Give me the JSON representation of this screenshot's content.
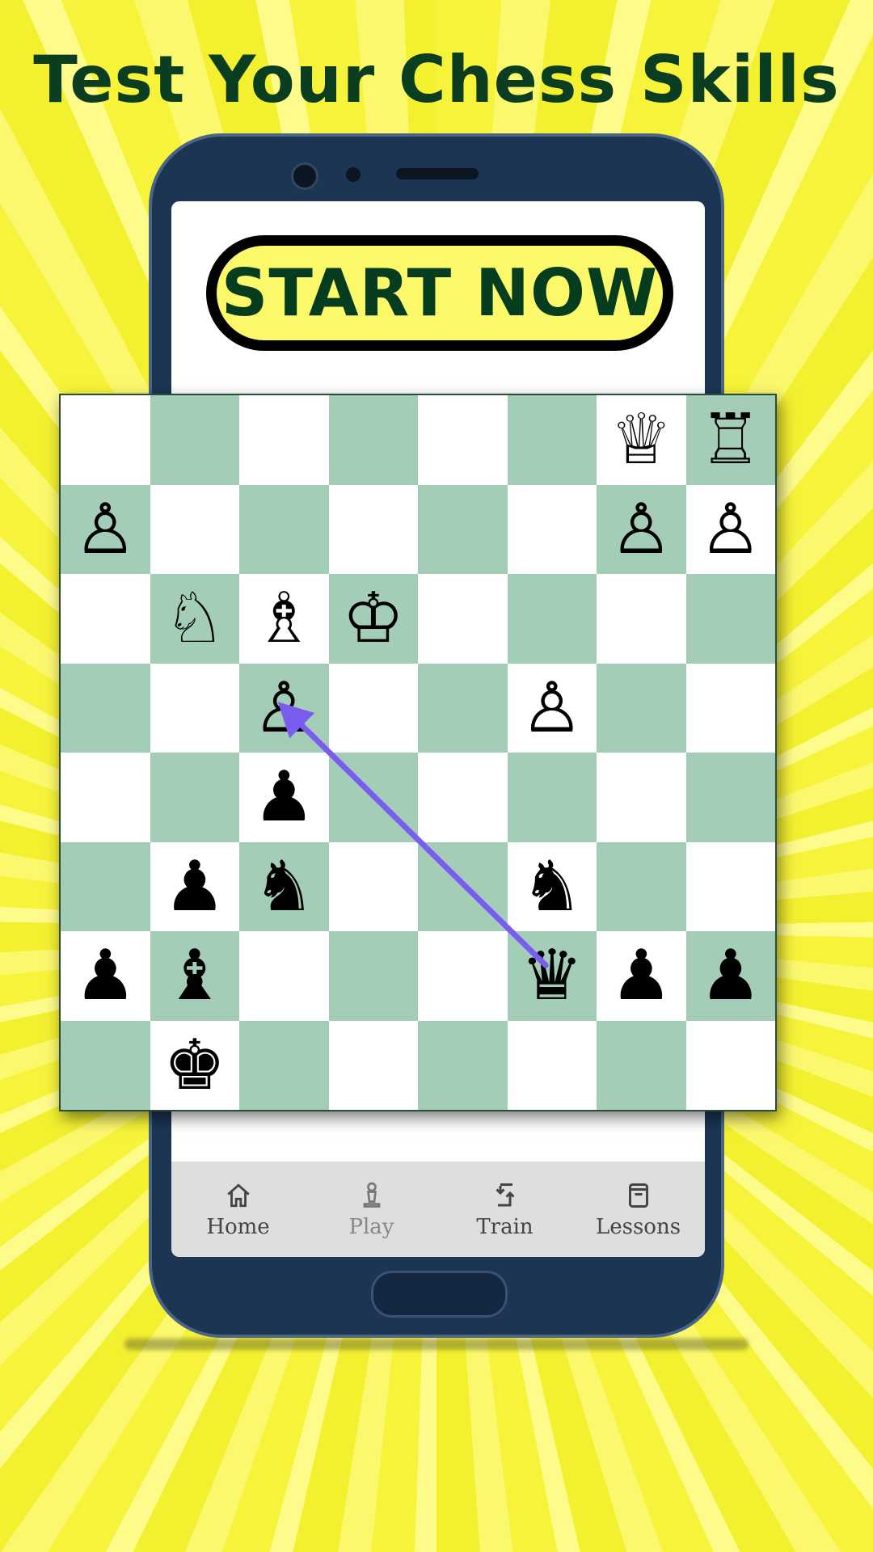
{
  "title": "Test Your Chess Skills",
  "start_button": "START NOW",
  "nav": [
    {
      "label": "Home",
      "icon": "home-icon"
    },
    {
      "label": "Play",
      "icon": "pawn-icon"
    },
    {
      "label": "Train",
      "icon": "swap-icon"
    },
    {
      "label": "Lessons",
      "icon": "book-icon"
    }
  ],
  "colors": {
    "title": "#0b3d20",
    "light_square": "#ffffff",
    "dark_square": "#a4cdb8",
    "arrow": "#7a5cf0",
    "button_fill": "#fbf86a"
  },
  "board": {
    "rows": [
      [
        "",
        "",
        "",
        "",
        "",
        "",
        "white-queen",
        "white-rook"
      ],
      [
        "white-pawn",
        "",
        "",
        "",
        "",
        "",
        "white-pawn",
        "white-pawn"
      ],
      [
        "",
        "white-knight",
        "white-bishop",
        "white-king",
        "",
        "",
        "",
        ""
      ],
      [
        "",
        "",
        "white-pawn",
        "",
        "",
        "white-pawn",
        "",
        ""
      ],
      [
        "",
        "",
        "black-pawn",
        "",
        "",
        "",
        "",
        ""
      ],
      [
        "",
        "black-pawn",
        "black-knight",
        "",
        "",
        "black-knight",
        "",
        ""
      ],
      [
        "black-pawn",
        "black-bishop",
        "",
        "",
        "",
        "black-queen",
        "black-pawn",
        "black-pawn"
      ],
      [
        "",
        "black-king",
        "",
        "",
        "",
        "",
        "",
        ""
      ]
    ],
    "arrow": {
      "from": [
        6,
        5
      ],
      "to": [
        3,
        2
      ]
    }
  }
}
